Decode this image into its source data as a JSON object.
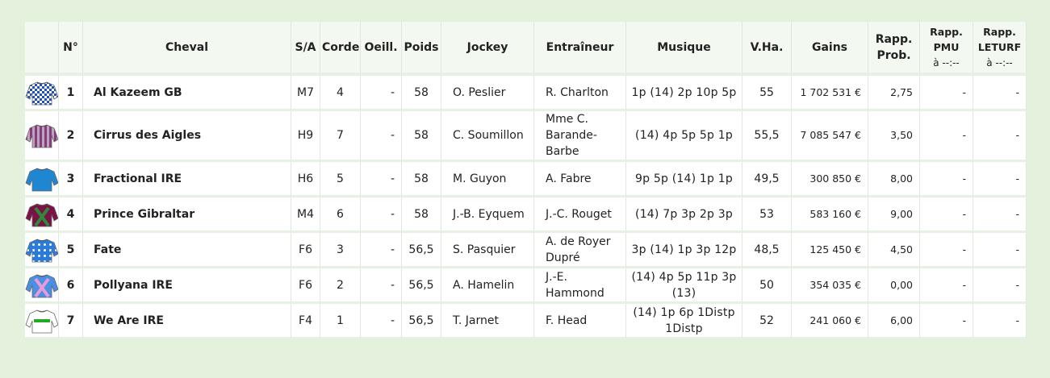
{
  "headers": {
    "silk": "",
    "no": "N°",
    "cheval": "Cheval",
    "sa": "S/A",
    "corde": "Corde",
    "oeill": "Oeill.",
    "poids": "Poids",
    "jockey": "Jockey",
    "entraineur": "Entraîneur",
    "musique": "Musique",
    "vha": "V.Ha.",
    "gains": "Gains",
    "rapp_prob_1": "Rapp.",
    "rapp_prob_2": "Prob.",
    "rapp_pmu_1": "Rapp.",
    "rapp_pmu_2": "PMU",
    "rapp_pmu_3": "à --:--",
    "rapp_leturf_1": "Rapp.",
    "rapp_leturf_2": "LETURF",
    "rapp_leturf_3": "à --:--"
  },
  "rows": [
    {
      "no": "1",
      "cheval": "Al Kazeem GB",
      "sa": "M7",
      "corde": "4",
      "oeill": "-",
      "poids": "58",
      "jockey": "O. Peslier",
      "entraineur": "R. Charlton",
      "musique": "1p (14) 2p 10p 5p",
      "vha": "55",
      "gains": "1 702 531 €",
      "rapp_prob": "2,75",
      "rapp_pmu": "-",
      "rapp_leturf": "-",
      "silk": "blue-white-check"
    },
    {
      "no": "2",
      "cheval": "Cirrus des Aigles",
      "sa": "H9",
      "corde": "7",
      "oeill": "-",
      "poids": "58",
      "jockey": "C. Soumillon",
      "entraineur": "Mme C. Barande-Barbe",
      "musique": "(14) 4p 5p 5p 1p",
      "vha": "55,5",
      "gains": "7 085 547 €",
      "rapp_prob": "3,50",
      "rapp_pmu": "-",
      "rapp_leturf": "-",
      "silk": "purple-grey-stripes"
    },
    {
      "no": "3",
      "cheval": "Fractional IRE",
      "sa": "H6",
      "corde": "5",
      "oeill": "-",
      "poids": "58",
      "jockey": "M. Guyon",
      "entraineur": "A. Fabre",
      "musique": "9p 5p (14) 1p 1p",
      "vha": "49,5",
      "gains": "300 850 €",
      "rapp_prob": "8,00",
      "rapp_pmu": "-",
      "rapp_leturf": "-",
      "silk": "blue-plain"
    },
    {
      "no": "4",
      "cheval": "Prince Gibraltar",
      "sa": "M4",
      "corde": "6",
      "oeill": "-",
      "poids": "58",
      "jockey": "J.-B. Eyquem",
      "entraineur": "J.-C. Rouget",
      "musique": "(14) 7p 3p 2p 3p",
      "vha": "53",
      "gains": "583 160 €",
      "rapp_prob": "9,00",
      "rapp_pmu": "-",
      "rapp_leturf": "-",
      "silk": "maroon-green-cross"
    },
    {
      "no": "5",
      "cheval": "Fate",
      "sa": "F6",
      "corde": "3",
      "oeill": "-",
      "poids": "56,5",
      "jockey": "S. Pasquier",
      "entraineur": "A. de Royer Dupré",
      "musique": "3p (14) 1p 3p 12p",
      "vha": "48,5",
      "gains": "125 450 €",
      "rapp_prob": "4,50",
      "rapp_pmu": "-",
      "rapp_leturf": "-",
      "silk": "blue-white-spots"
    },
    {
      "no": "6",
      "cheval": "Pollyana IRE",
      "sa": "F6",
      "corde": "2",
      "oeill": "-",
      "poids": "56,5",
      "jockey": "A. Hamelin",
      "entraineur": "J.-E. Hammond",
      "musique": "(14) 4p 5p 11p 3p (13)",
      "vha": "50",
      "gains": "354 035 €",
      "rapp_prob": "0,00",
      "rapp_pmu": "-",
      "rapp_leturf": "-",
      "silk": "blue-pink-cross"
    },
    {
      "no": "7",
      "cheval": "We Are IRE",
      "sa": "F4",
      "corde": "1",
      "oeill": "-",
      "poids": "56,5",
      "jockey": "T. Jarnet",
      "entraineur": "F. Head",
      "musique": "(14) 1p 6p 1Distp 1Distp",
      "vha": "52",
      "gains": "241 060 €",
      "rapp_prob": "6,00",
      "rapp_pmu": "-",
      "rapp_leturf": "-",
      "silk": "white-green-band"
    }
  ]
}
